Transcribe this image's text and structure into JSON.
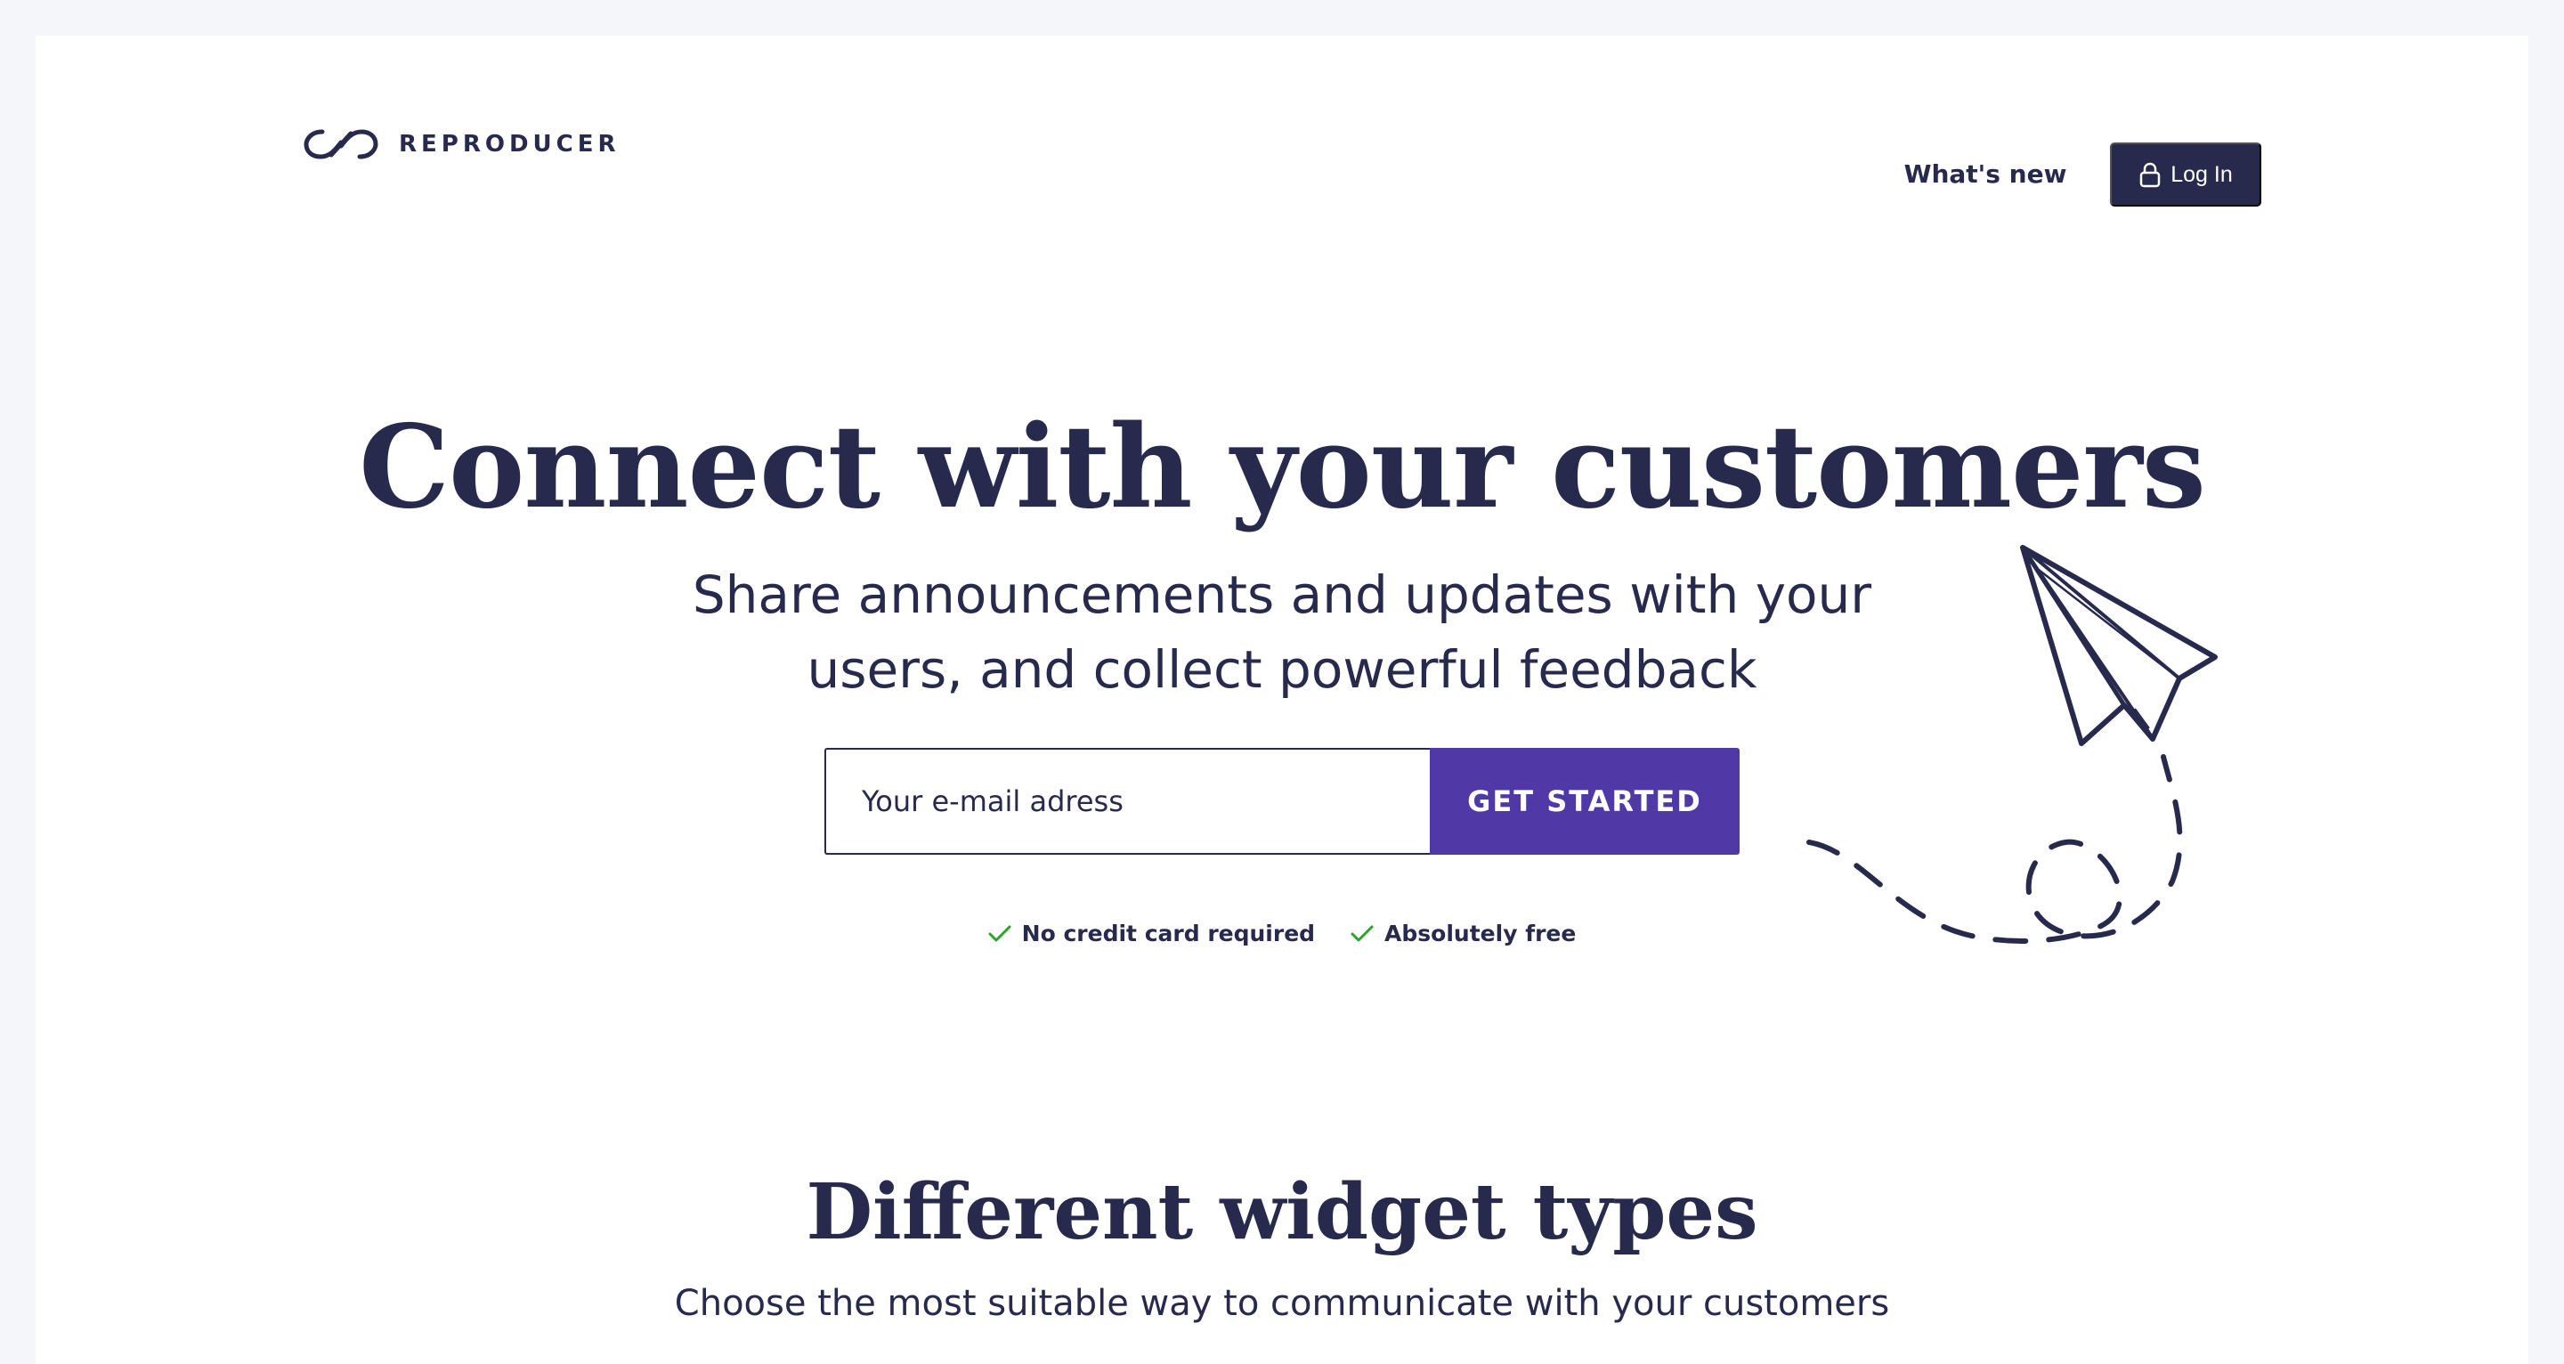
{
  "header": {
    "brand": "REPRODUCER",
    "nav_whats_new": "What's new",
    "login_label": "Log In"
  },
  "hero": {
    "title": "Connect with your customers",
    "subtitle_line1": "Share announcements and updates with your",
    "subtitle_line2": "users, and collect powerful feedback",
    "email_placeholder": "Your e-mail adress",
    "cta_label": "GET STARTED",
    "perks": [
      "No credit card required",
      "Absolutely free"
    ]
  },
  "section": {
    "title": "Different widget types",
    "subtitle": "Choose the most suitable way to communicate with your customers"
  },
  "colors": {
    "text": "#272a4d",
    "accent": "#5039a6",
    "check": "#2aa52a",
    "background": "#f5f6f9"
  },
  "icons": {
    "logo": "infinity-link-icon",
    "login": "lock-icon",
    "perk": "check-icon",
    "illustration": "paper-plane-icon"
  }
}
